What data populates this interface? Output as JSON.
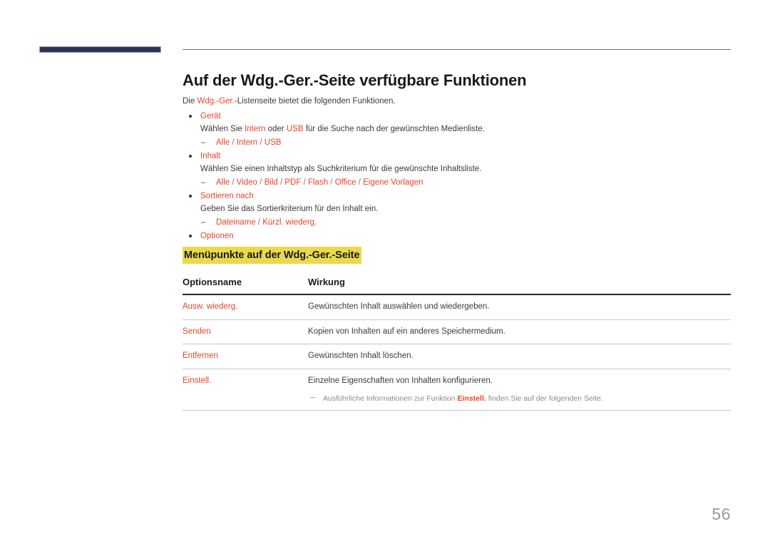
{
  "header": {
    "title": "Auf der Wdg.-Ger.-Seite verfügbare Funktionen",
    "intro_prefix": "Die ",
    "intro_accent": "Wdg.-Ger.",
    "intro_suffix": "-Listenseite bietet die folgenden Funktionen."
  },
  "bullets": [
    {
      "label": "Gerät",
      "description_parts": [
        {
          "text": "Wählen Sie ",
          "accent": false
        },
        {
          "text": "Intern",
          "accent": true
        },
        {
          "text": " oder ",
          "accent": false
        },
        {
          "text": "USB",
          "accent": true
        },
        {
          "text": " für die Suche nach der gewünschten Medienliste.",
          "accent": false
        }
      ],
      "options": [
        "Alle",
        "Intern",
        "USB"
      ]
    },
    {
      "label": "Inhalt",
      "description_parts": [
        {
          "text": "Wählen Sie einen Inhaltstyp als Suchkriterium für die gewünschte Inhaltsliste.",
          "accent": false
        }
      ],
      "options": [
        "Alle",
        "Video",
        "Bild",
        "PDF",
        "Flash",
        "Office",
        "Eigene Vorlagen"
      ]
    },
    {
      "label": "Sortieren nach",
      "description_parts": [
        {
          "text": "Geben Sie das Sortierkriterium für den Inhalt ein.",
          "accent": false
        }
      ],
      "options": [
        "Dateiname",
        "Kürzl. wiederg."
      ]
    },
    {
      "label": "Optionen",
      "description_parts": [],
      "options": []
    }
  ],
  "sub_heading": "Menüpunkte auf der Wdg.-Ger.-Seite",
  "table": {
    "headers": [
      "Optionsname",
      "Wirkung"
    ],
    "rows": [
      {
        "option": "Ausw. wiederg.",
        "effect": "Gewünschten Inhalt auswählen und wiedergeben."
      },
      {
        "option": "Senden",
        "effect": "Kopien von Inhalten auf ein anderes Speichermedium."
      },
      {
        "option": "Entfernen",
        "effect": "Gewünschten Inhalt löschen."
      },
      {
        "option": "Einstell.",
        "effect": "Einzelne Eigenschaften von Inhalten konfigurieren.",
        "note_prefix": "Ausführliche Informationen zur Funktion ",
        "note_accent": "Einstell.",
        "note_suffix": " finden Sie auf der folgenden Seite."
      }
    ]
  },
  "page_number": "56",
  "colors": {
    "accent": "#e8432a",
    "highlight": "#ebd94b",
    "deco_bar": "#2b3553",
    "body_text": "#3a3a3a",
    "note_text": "#8a8a8a"
  },
  "separator": "/"
}
